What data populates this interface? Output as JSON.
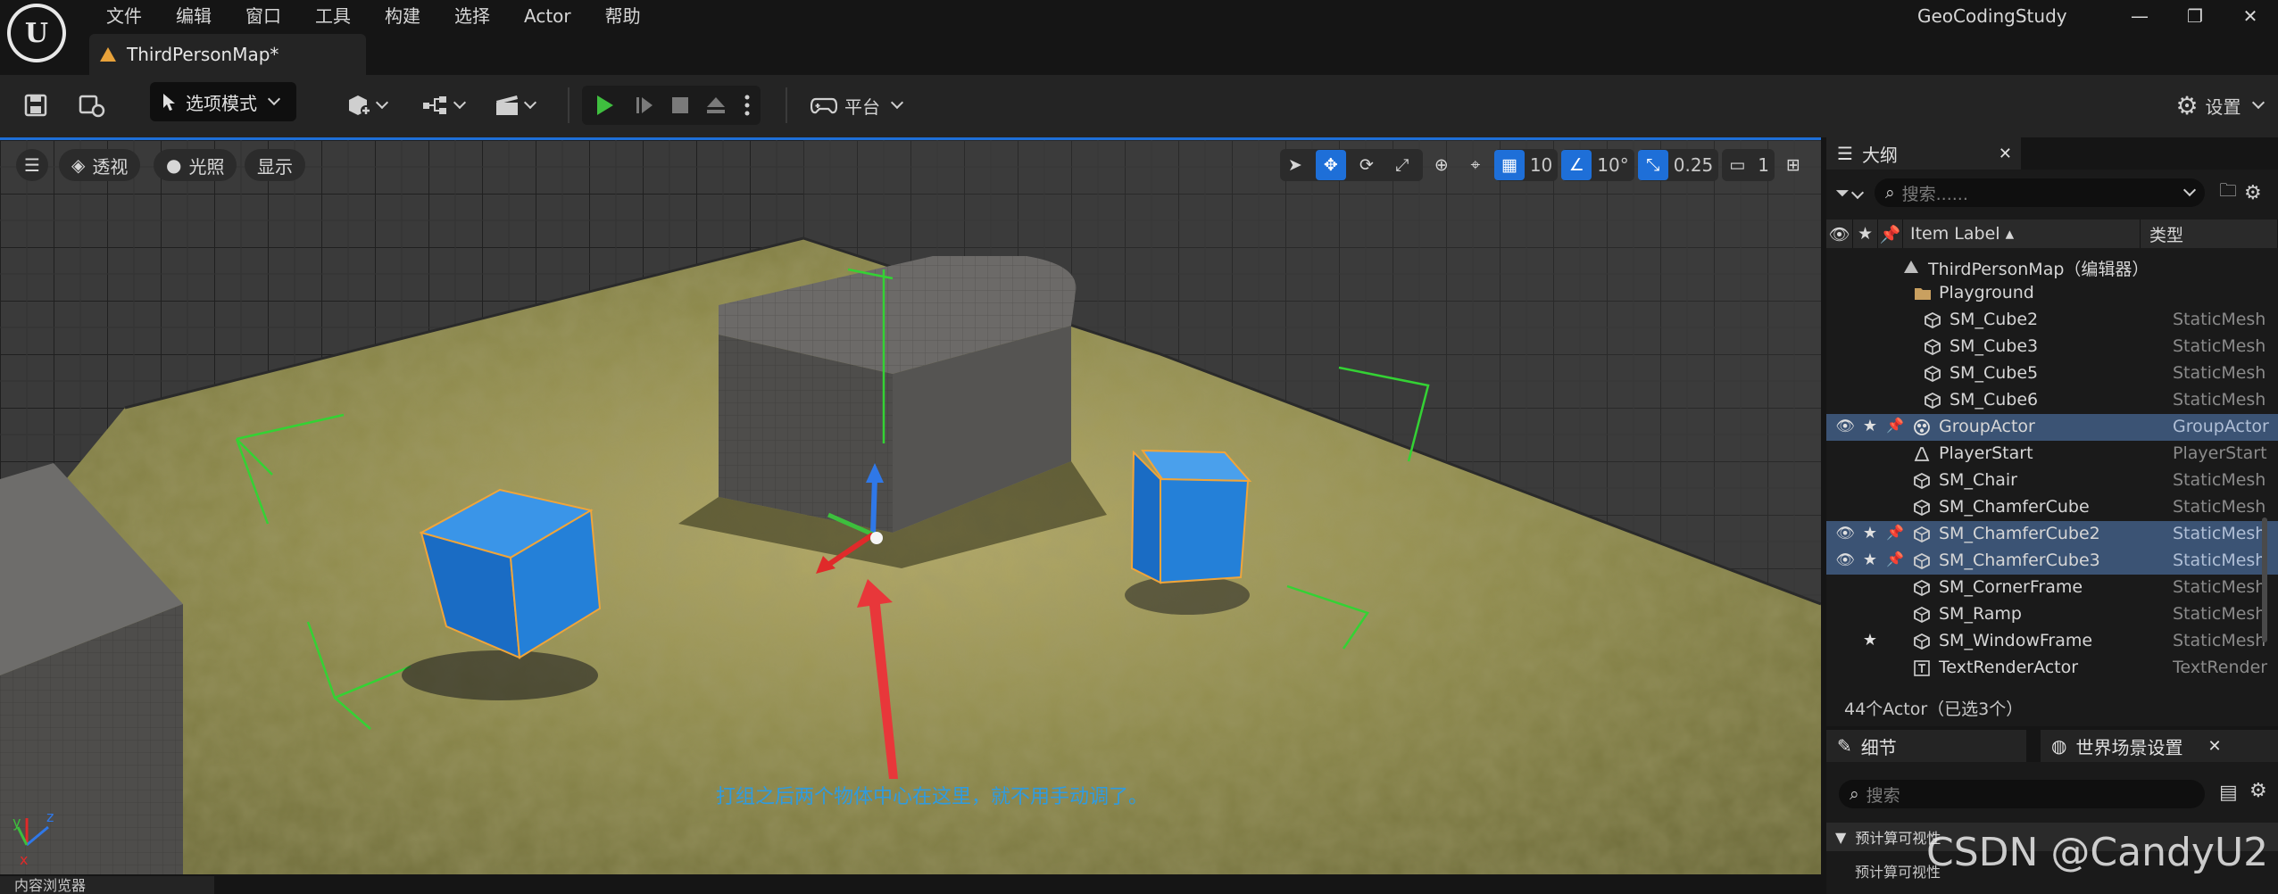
{
  "menu": [
    "文件",
    "编辑",
    "窗口",
    "工具",
    "构建",
    "选择",
    "Actor",
    "帮助"
  ],
  "project_name": "GeoCodingStudy",
  "document_tab": "ThirdPersonMap*",
  "toolbar": {
    "mode_label": "选项模式",
    "platform_label": "平台",
    "settings_label": "设置"
  },
  "viewport": {
    "view_label": "透视",
    "lighting_label": "光照",
    "show_label": "显示",
    "grid_snap": "10",
    "rotation_snap": "10°",
    "scale_snap": "0.25",
    "camera_speed": "1",
    "annotation": "打组之后两个物体中心在这里，就不用手动调了。",
    "axis_x": "x",
    "axis_y": "y",
    "axis_z": "z"
  },
  "outliner": {
    "tab_label": "大纲",
    "search_placeholder": "搜索......",
    "col_label": "Item Label ▴",
    "col_type": "类型",
    "rows": [
      {
        "label": "ThirdPersonMap（编辑器）",
        "type": "",
        "indent": 0,
        "icon": "level",
        "selected": false,
        "vis": false,
        "star": false,
        "pin": false
      },
      {
        "label": "Playground",
        "type": "",
        "indent": 1,
        "icon": "folder",
        "selected": false,
        "vis": false,
        "star": false,
        "pin": false
      },
      {
        "label": "SM_Cube2",
        "type": "StaticMesh",
        "indent": 2,
        "icon": "mesh",
        "selected": false,
        "vis": false,
        "star": false,
        "pin": false
      },
      {
        "label": "SM_Cube3",
        "type": "StaticMesh",
        "indent": 2,
        "icon": "mesh",
        "selected": false,
        "vis": false,
        "star": false,
        "pin": false
      },
      {
        "label": "SM_Cube5",
        "type": "StaticMesh",
        "indent": 2,
        "icon": "mesh",
        "selected": false,
        "vis": false,
        "star": false,
        "pin": false
      },
      {
        "label": "SM_Cube6",
        "type": "StaticMesh",
        "indent": 2,
        "icon": "mesh",
        "selected": false,
        "vis": false,
        "star": false,
        "pin": false
      },
      {
        "label": "GroupActor",
        "type": "GroupActor",
        "indent": 1,
        "icon": "group",
        "selected": true,
        "vis": true,
        "star": true,
        "pin": true
      },
      {
        "label": "PlayerStart",
        "type": "PlayerStart",
        "indent": 1,
        "icon": "player",
        "selected": false,
        "vis": false,
        "star": false,
        "pin": false
      },
      {
        "label": "SM_Chair",
        "type": "StaticMesh",
        "indent": 1,
        "icon": "mesh",
        "selected": false,
        "vis": false,
        "star": false,
        "pin": false
      },
      {
        "label": "SM_ChamferCube",
        "type": "StaticMesh",
        "indent": 1,
        "icon": "mesh",
        "selected": false,
        "vis": false,
        "star": false,
        "pin": false
      },
      {
        "label": "SM_ChamferCube2",
        "type": "StaticMesh",
        "indent": 1,
        "icon": "mesh",
        "selected": true,
        "vis": true,
        "star": true,
        "pin": true
      },
      {
        "label": "SM_ChamferCube3",
        "type": "StaticMesh",
        "indent": 1,
        "icon": "mesh",
        "selected": true,
        "vis": true,
        "star": true,
        "pin": true
      },
      {
        "label": "SM_CornerFrame",
        "type": "StaticMesh",
        "indent": 1,
        "icon": "mesh",
        "selected": false,
        "vis": false,
        "star": false,
        "pin": false
      },
      {
        "label": "SM_Ramp",
        "type": "StaticMesh",
        "indent": 1,
        "icon": "mesh",
        "selected": false,
        "vis": false,
        "star": false,
        "pin": false
      },
      {
        "label": "SM_WindowFrame",
        "type": "StaticMesh",
        "indent": 1,
        "icon": "mesh",
        "selected": false,
        "vis": false,
        "star": true,
        "pin": false
      },
      {
        "label": "TextRenderActor",
        "type": "TextRender",
        "indent": 1,
        "icon": "text",
        "selected": false,
        "vis": false,
        "star": false,
        "pin": false
      }
    ],
    "footer": "44个Actor（已选3个）"
  },
  "details": {
    "tab_label": "细节",
    "world_settings_label": "世界场景设置",
    "search_placeholder": "搜索",
    "category_label": "预计算可视性",
    "property_label": "预计算可视性"
  },
  "content_browser_label": "内容浏览器",
  "watermark": "CSDN @CandyU2",
  "colors": {
    "accent": "#1e6fd8",
    "selected_row": "#3b5374",
    "play_green": "#3fbf3f",
    "cube_blue": "#1e7ed6",
    "annotation": "#2f9be0"
  }
}
